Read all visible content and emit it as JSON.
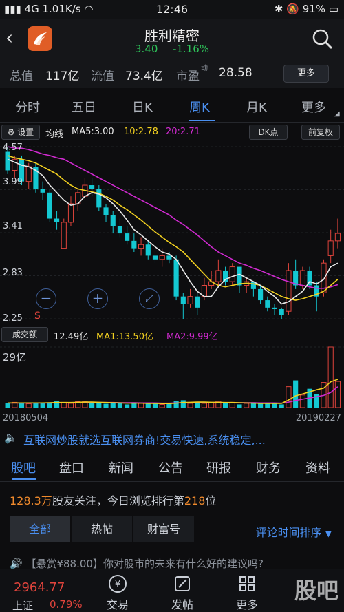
{
  "status_bar": {
    "signal": "4G",
    "speed": "1.01K/s",
    "time": "12:46",
    "battery": "91%"
  },
  "header": {
    "stock_name": "胜利精密",
    "price": "3.40",
    "change": "-1.16%"
  },
  "metrics": {
    "total_value_label": "总值",
    "total_value": "117亿",
    "float_value_label": "流值",
    "float_value": "73.4亿",
    "pe_label": "市盈",
    "pe_sup": "动",
    "pe_value": "28.58",
    "more_button": "更多"
  },
  "period_tabs": [
    "分时",
    "五日",
    "日K",
    "周K",
    "月K",
    "更多"
  ],
  "active_period": "周K",
  "ma_bar": {
    "settings": "设置",
    "label": "均线",
    "ma5": "MA5:3.00",
    "ma10": "10:2.78",
    "ma20": "20:2.71",
    "dk_button": "DK点",
    "adjust_button": "前复权"
  },
  "price_axis": [
    "4.57",
    "3.99",
    "3.41",
    "2.83",
    "2.25"
  ],
  "chart_marker": "S",
  "volume_bar": {
    "label": "成交额",
    "value": "12.49亿",
    "ma1": "MA1:13.50亿",
    "ma2": "MA2:9.99亿",
    "axis_max": "29亿"
  },
  "dates": {
    "start": "20180504",
    "end": "20190227"
  },
  "ad_text": "互联网炒股就选互联网券商!交易快速,系统稳定,...",
  "community_tabs": [
    "股吧",
    "盘口",
    "新闻",
    "公告",
    "研报",
    "财务",
    "资料"
  ],
  "active_community_tab": "股吧",
  "follow": {
    "count": "128.3万",
    "text_a": "股友关注，今日浏览排行第",
    "rank": "218",
    "text_b": "位"
  },
  "segments": [
    "全部",
    "热帖",
    "财富号"
  ],
  "sort_label": "评论时间排序",
  "post_preview": "【悬赏¥88.00】你对股市的未来有什么好的建议吗?",
  "bottom": {
    "index_value": "2964.77",
    "index_name": "上证",
    "index_change": "0.79%",
    "items": [
      "交易",
      "发帖",
      "更多"
    ],
    "watermark": "股吧"
  },
  "colors": {
    "up": "#e0443c",
    "down": "#14c8d2",
    "ma5": "#e8e8e8",
    "ma10": "#f2d020",
    "ma20": "#d02ad0",
    "accent": "#4a8ff0"
  },
  "chart_data": {
    "type": "candlestick",
    "x_start": "20180504",
    "x_end": "20190227",
    "y_ticks": [
      4.57,
      3.99,
      3.41,
      2.83,
      2.25
    ],
    "ylim": [
      2.25,
      4.57
    ],
    "candles": [
      [
        4.5,
        4.25,
        4.57,
        4.2
      ],
      [
        4.25,
        4.4,
        4.45,
        4.15
      ],
      [
        4.4,
        4.1,
        4.45,
        4.05
      ],
      [
        4.1,
        4.3,
        4.35,
        4.0
      ],
      [
        4.3,
        4.0,
        4.35,
        3.95
      ],
      [
        4.0,
        3.95,
        4.1,
        3.85
      ],
      [
        3.95,
        3.6,
        4.0,
        3.55
      ],
      [
        3.6,
        3.55,
        3.7,
        3.45
      ],
      [
        3.2,
        3.55,
        3.6,
        3.2
      ],
      [
        3.55,
        3.8,
        3.9,
        3.5
      ],
      [
        3.8,
        3.95,
        4.0,
        3.7
      ],
      [
        3.9,
        4.05,
        4.15,
        3.85
      ],
      [
        4.05,
        4.0,
        4.15,
        3.9
      ],
      [
        4.0,
        3.75,
        4.05,
        3.7
      ],
      [
        3.75,
        3.65,
        3.8,
        3.55
      ],
      [
        3.65,
        3.5,
        3.7,
        3.4
      ],
      [
        3.5,
        3.4,
        3.6,
        3.35
      ],
      [
        3.4,
        3.3,
        3.5,
        3.25
      ],
      [
        3.3,
        3.2,
        3.4,
        3.15
      ],
      [
        3.2,
        3.25,
        3.35,
        3.1
      ],
      [
        3.25,
        3.1,
        3.3,
        3.05
      ],
      [
        3.1,
        3.05,
        3.2,
        3.0
      ],
      [
        3.05,
        3.1,
        3.2,
        2.95
      ],
      [
        3.1,
        3.05,
        3.15,
        3.0
      ],
      [
        3.05,
        2.55,
        3.1,
        2.5
      ],
      [
        2.55,
        2.45,
        2.6,
        2.25
      ],
      [
        2.45,
        2.55,
        2.65,
        2.4
      ],
      [
        2.55,
        2.4,
        2.6,
        2.3
      ],
      [
        2.55,
        2.7,
        2.8,
        2.5
      ],
      [
        2.7,
        2.75,
        2.9,
        2.65
      ],
      [
        2.75,
        2.9,
        3.05,
        2.7
      ],
      [
        2.9,
        2.75,
        2.95,
        2.7
      ],
      [
        2.75,
        2.95,
        3.0,
        2.7
      ],
      [
        2.95,
        2.7,
        2.95,
        2.6
      ],
      [
        2.7,
        2.75,
        2.8,
        2.6
      ],
      [
        2.75,
        2.65,
        2.75,
        2.55
      ],
      [
        2.65,
        2.5,
        2.7,
        2.45
      ],
      [
        2.5,
        2.4,
        2.55,
        2.35
      ],
      [
        2.4,
        2.38,
        2.45,
        2.3
      ],
      [
        2.38,
        2.3,
        2.4,
        2.25
      ],
      [
        2.35,
        2.9,
        3.0,
        2.3
      ],
      [
        2.9,
        2.7,
        3.05,
        2.65
      ],
      [
        2.7,
        2.9,
        2.95,
        2.65
      ],
      [
        2.9,
        2.7,
        2.95,
        2.65
      ],
      [
        2.7,
        2.55,
        2.75,
        2.35
      ],
      [
        2.6,
        3.0,
        3.05,
        2.55
      ],
      [
        3.1,
        3.3,
        3.45,
        3.0
      ],
      [
        3.3,
        3.4,
        3.6,
        3.2
      ]
    ],
    "ma5": [
      4.4,
      4.36,
      4.32,
      4.3,
      4.25,
      4.18,
      4.05,
      3.95,
      3.85,
      3.78,
      3.8,
      3.9,
      3.95,
      3.93,
      3.88,
      3.8,
      3.7,
      3.58,
      3.45,
      3.38,
      3.3,
      3.22,
      3.15,
      3.12,
      3.05,
      2.9,
      2.75,
      2.62,
      2.55,
      2.55,
      2.68,
      2.78,
      2.82,
      2.85,
      2.8,
      2.75,
      2.7,
      2.62,
      2.55,
      2.45,
      2.48,
      2.55,
      2.62,
      2.75,
      2.72,
      2.78,
      2.95,
      3.0
    ],
    "ma10": [
      4.45,
      4.42,
      4.4,
      4.38,
      4.35,
      4.3,
      4.25,
      4.2,
      4.12,
      4.05,
      4.0,
      3.98,
      3.96,
      3.94,
      3.9,
      3.85,
      3.78,
      3.72,
      3.65,
      3.58,
      3.5,
      3.42,
      3.35,
      3.28,
      3.22,
      3.15,
      3.05,
      2.95,
      2.85,
      2.75,
      2.7,
      2.68,
      2.7,
      2.72,
      2.73,
      2.72,
      2.7,
      2.65,
      2.6,
      2.55,
      2.52,
      2.5,
      2.52,
      2.55,
      2.58,
      2.62,
      2.7,
      2.78
    ],
    "ma20": [
      4.57,
      4.55,
      4.55,
      4.53,
      4.5,
      4.47,
      4.45,
      4.42,
      4.4,
      4.35,
      4.3,
      4.25,
      4.2,
      4.15,
      4.1,
      4.05,
      4.0,
      3.95,
      3.9,
      3.85,
      3.8,
      3.75,
      3.7,
      3.65,
      3.58,
      3.52,
      3.45,
      3.38,
      3.3,
      3.22,
      3.15,
      3.1,
      3.05,
      3.0,
      2.97,
      2.93,
      2.9,
      2.86,
      2.82,
      2.78,
      2.75,
      2.72,
      2.7,
      2.68,
      2.66,
      2.66,
      2.68,
      2.71
    ],
    "volume_max": 29,
    "volume": [
      2.0,
      2.5,
      2.0,
      1.8,
      2.2,
      2.0,
      2.5,
      3.0,
      2.5,
      2.0,
      2.8,
      3.0,
      2.5,
      2.0,
      1.8,
      2.2,
      2.0,
      1.5,
      2.5,
      2.0,
      1.8,
      2.2,
      1.5,
      2.0,
      3.0,
      3.5,
      2.0,
      2.5,
      2.0,
      2.5,
      3.0,
      2.0,
      2.5,
      1.5,
      2.0,
      2.5,
      1.8,
      2.2,
      2.0,
      1.5,
      10.0,
      13.0,
      6.0,
      9.0,
      6.5,
      12.0,
      29.0,
      12.49
    ],
    "vol_ma1": [
      2.2,
      2.2,
      2.2,
      2.2,
      2.2,
      2.2,
      2.3,
      2.4,
      2.4,
      2.4,
      2.5,
      2.6,
      2.6,
      2.5,
      2.4,
      2.3,
      2.2,
      2.1,
      2.1,
      2.1,
      2.0,
      2.0,
      1.9,
      1.9,
      2.1,
      2.4,
      2.5,
      2.6,
      2.6,
      2.5,
      2.5,
      2.4,
      2.4,
      2.3,
      2.2,
      2.1,
      2.0,
      2.0,
      2.0,
      2.0,
      3.6,
      5.6,
      6.5,
      7.5,
      8.5,
      9.3,
      12.3,
      13.5
    ],
    "vol_ma2": [
      2.2,
      2.2,
      2.2,
      2.2,
      2.2,
      2.2,
      2.2,
      2.3,
      2.3,
      2.3,
      2.4,
      2.4,
      2.4,
      2.4,
      2.4,
      2.4,
      2.3,
      2.3,
      2.3,
      2.2,
      2.2,
      2.2,
      2.1,
      2.1,
      2.2,
      2.3,
      2.3,
      2.3,
      2.3,
      2.3,
      2.3,
      2.3,
      2.3,
      2.3,
      2.3,
      2.3,
      2.2,
      2.2,
      2.2,
      2.1,
      2.6,
      3.4,
      4.0,
      4.6,
      5.2,
      5.8,
      7.2,
      9.99
    ]
  }
}
